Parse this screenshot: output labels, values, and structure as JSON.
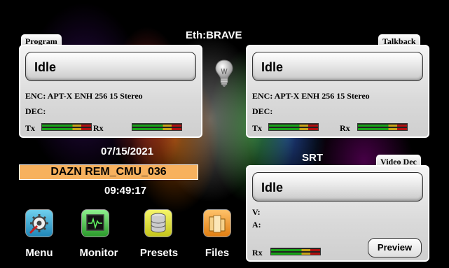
{
  "header": {
    "network_label": "Eth:BRAVE"
  },
  "program": {
    "tab": "Program",
    "status": "Idle",
    "enc": "ENC: APT-X ENH 256 15 Stereo",
    "dec": "DEC:",
    "tx_label": "Tx",
    "rx_label": "Rx"
  },
  "talkback": {
    "tab": "Talkback",
    "status": "Idle",
    "enc": "ENC: APT-X ENH 256 15 Stereo",
    "dec": "DEC:",
    "tx_label": "Tx",
    "rx_label": "Rx"
  },
  "info": {
    "date": "07/15/2021",
    "name": "DAZN REM_CMU_036",
    "time": "09:49:17"
  },
  "srt": {
    "title": "SRT",
    "tab": "Video Dec",
    "status": "Idle",
    "video": "V:",
    "audio": "A:",
    "rx_label": "Rx",
    "preview_label": "Preview"
  },
  "toolbar": {
    "items": [
      {
        "label": "Menu",
        "icon": "gear-icon"
      },
      {
        "label": "Monitor",
        "icon": "monitor-icon"
      },
      {
        "label": "Presets",
        "icon": "database-icon"
      },
      {
        "label": "Files",
        "icon": "folder-icon"
      }
    ]
  },
  "colors": {
    "name_banner": "#f7b15e",
    "meter_green": "#19a319",
    "meter_yellow": "#c8a418",
    "meter_red": "#b01010"
  }
}
